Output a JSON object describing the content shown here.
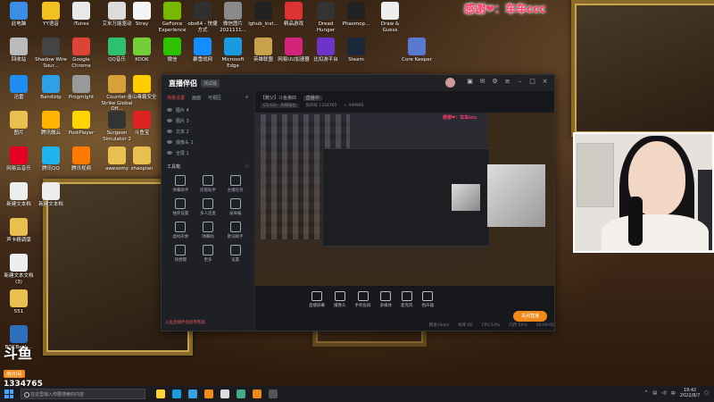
{
  "watermark": "感谢❤：车车ccc",
  "desktop_icons": [
    {
      "label": "此电脑",
      "color": "#3a8ee6"
    },
    {
      "label": "YY语音",
      "color": "#f2c020"
    },
    {
      "label": "iTunes",
      "color": "#e8e8e8"
    },
    {
      "label": "艾米万能驱动",
      "color": "#dcdcdc"
    },
    {
      "label": "Stray",
      "color": "#f5f5f5"
    },
    {
      "label": "GeForce Experience",
      "color": "#76b900"
    },
    {
      "label": "obs64 - 快捷方式",
      "color": "#303030"
    },
    {
      "label": "微信图片 2021111...",
      "color": "#8a8a8a"
    },
    {
      "label": "lghub_inst...",
      "color": "#222"
    },
    {
      "label": "精品游戏",
      "color": "#d33"
    },
    {
      "label": "Dread Hunger",
      "color": "#333"
    },
    {
      "label": "Phasmop...",
      "color": "#222"
    },
    {
      "label": "Draw & Guess",
      "color": "#eee"
    },
    {
      "label": "回收站",
      "color": "#bbb"
    },
    {
      "label": "Shadow Wire Sour...",
      "color": "#444"
    },
    {
      "label": "Google Chrome",
      "color": "#db4437"
    },
    {
      "label": "QQ音乐",
      "color": "#2ec16f"
    },
    {
      "label": "KOOK",
      "color": "#74ce3a"
    },
    {
      "label": "微信",
      "color": "#2dc100"
    },
    {
      "label": "暴雪战网",
      "color": "#148eff"
    },
    {
      "label": "Microsoft Edge",
      "color": "#1a9be0"
    },
    {
      "label": "英雄联盟",
      "color": "#c8a24a"
    },
    {
      "label": "网易UU加速器",
      "color": "#d4237a"
    },
    {
      "label": "比扣游平台",
      "color": "#6e34c8"
    },
    {
      "label": "Steam",
      "color": "#1b2838"
    },
    {
      "label": "Core Keeper",
      "color": "#5a7ad0"
    },
    {
      "label": "迅雷",
      "color": "#1e8cf0"
    },
    {
      "label": "Bandizip",
      "color": "#2ea0e8"
    },
    {
      "label": "Progmight",
      "color": "#999"
    },
    {
      "label": "Counter-Strike Global Off...",
      "color": "#d7a13a"
    },
    {
      "label": "金山毒霸安全",
      "color": "#ffcc00"
    },
    {
      "label": "图片",
      "color": "#e8c050"
    },
    {
      "label": "腾讯微云",
      "color": "#ffb400"
    },
    {
      "label": "PostPlayer",
      "color": "#ffd400"
    },
    {
      "label": "Surgeon Simulator 2",
      "color": "#333"
    },
    {
      "label": "斗鱼宝",
      "color": "#d22"
    },
    {
      "label": "Dota 2",
      "color": "#b22"
    },
    {
      "label": "网易云音乐",
      "color": "#e60026"
    },
    {
      "label": "腾讯QQ",
      "color": "#1eb4f0"
    },
    {
      "label": "腾讯视频",
      "color": "#ff7a00"
    },
    {
      "label": "awesomy",
      "color": "#e8c050"
    },
    {
      "label": "zhaopian",
      "color": "#e8c050"
    },
    {
      "label": "聚乐",
      "color": "#e8c050"
    },
    {
      "label": "新建文本档",
      "color": "#eee"
    },
    {
      "label": "新建文本档",
      "color": "#eee"
    },
    {
      "label": "声卡精调版",
      "color": "#e8c050"
    },
    {
      "label": "新建文本文档(3)",
      "color": "#eee"
    },
    {
      "label": "551",
      "color": "#e8c050"
    },
    {
      "label": "BOCBank...",
      "color": "#2d6fbd"
    },
    {
      "label": "签到",
      "color": "#cc4"
    },
    {
      "label": "斗鱼直播 2022051...",
      "color": "#f08a1a"
    }
  ],
  "app": {
    "logo": "直播伴侣",
    "beta_label": "测试版",
    "sidebar_tabs": [
      "场景设置",
      "画面",
      "可视区"
    ],
    "sources": [
      "图片 4",
      "图片 3",
      "文本 2",
      "摄像头 1",
      "全屏 1"
    ],
    "tools_title": "工具箱",
    "tools": [
      "弹幕助手",
      "房管助手",
      "主播任务",
      "抽奖设置",
      "多人连麦",
      "录屏编",
      "虚拟形象",
      "弹幕助",
      "歌词助手",
      "快捷键",
      "更多",
      "设置"
    ],
    "hint": "斗鱼直播伴侣使用帮助",
    "room_title": "【教父】斗鱼第四",
    "room_status": "直播中",
    "room_category": "CS:GO - 天梯排位",
    "room_meta_label": "房间号",
    "room_id": "1334765",
    "room_hot": "449995",
    "controls": [
      "直播屏幕",
      "摄像头",
      "手机投屏",
      "多媒体",
      "麦克风",
      "扬声器"
    ],
    "golive": "关闭直播",
    "status": [
      "网速:0kb/s",
      "帧率:60",
      "CPU:10%",
      "内存:50%",
      "00:00:00"
    ]
  },
  "douyu": {
    "brand": "斗鱼",
    "room_label": "房间号",
    "room_number": "1334765"
  },
  "taskbar": {
    "search_placeholder": "在这里输入你要搜索的内容",
    "apps": [
      "#ffd23c",
      "#1a9be0",
      "#3aa0e0",
      "#f08a1a",
      "#ddd",
      "#4a8",
      "#f08a1a",
      "#555"
    ],
    "time": "19:42",
    "date": "2022/8/7"
  }
}
